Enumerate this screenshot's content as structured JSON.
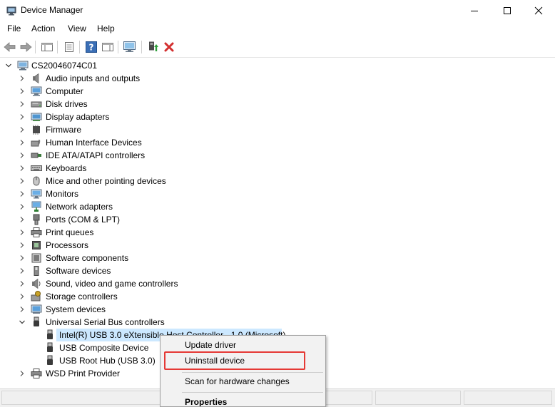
{
  "window": {
    "title": "Device Manager",
    "icon": "device-manager-icon"
  },
  "menu": {
    "items": [
      "File",
      "Action",
      "View",
      "Help"
    ]
  },
  "toolbar": {
    "buttons": [
      "back-arrow-icon",
      "forward-arrow-icon",
      "show-hide-console-tree-icon",
      "properties-icon",
      "help-icon",
      "action-pane-icon",
      "monitor-scan-icon",
      "update-driver-icon",
      "uninstall-x-icon"
    ]
  },
  "tree": {
    "root": "CS20046074C01",
    "categories": [
      {
        "label": "Audio inputs and outputs",
        "icon": "speaker-icon"
      },
      {
        "label": "Computer",
        "icon": "computer-icon"
      },
      {
        "label": "Disk drives",
        "icon": "disk-drive-icon"
      },
      {
        "label": "Display adapters",
        "icon": "display-adapter-icon"
      },
      {
        "label": "Firmware",
        "icon": "firmware-chip-icon"
      },
      {
        "label": "Human Interface Devices",
        "icon": "hid-icon"
      },
      {
        "label": "IDE ATA/ATAPI controllers",
        "icon": "ide-controller-icon"
      },
      {
        "label": "Keyboards",
        "icon": "keyboard-icon"
      },
      {
        "label": "Mice and other pointing devices",
        "icon": "mouse-icon"
      },
      {
        "label": "Monitors",
        "icon": "monitor-icon"
      },
      {
        "label": "Network adapters",
        "icon": "network-adapter-icon"
      },
      {
        "label": "Ports (COM & LPT)",
        "icon": "port-icon"
      },
      {
        "label": "Print queues",
        "icon": "printer-icon"
      },
      {
        "label": "Processors",
        "icon": "processor-icon"
      },
      {
        "label": "Software components",
        "icon": "software-component-icon"
      },
      {
        "label": "Software devices",
        "icon": "software-device-icon"
      },
      {
        "label": "Sound, video and game controllers",
        "icon": "sound-icon"
      },
      {
        "label": "Storage controllers",
        "icon": "storage-controller-icon"
      },
      {
        "label": "System devices",
        "icon": "system-device-icon"
      },
      {
        "label": "Universal Serial Bus controllers",
        "icon": "usb-icon"
      }
    ],
    "usb_children": [
      {
        "label": "Intel(R) USB 3.0 eXtensible Host Controller - 1.0 (Microsoft)",
        "selected": true
      },
      {
        "label": "USB Composite Device"
      },
      {
        "label": "USB Root Hub (USB 3.0)"
      }
    ],
    "last_category": {
      "label": "WSD Print Provider",
      "icon": "wsd-printer-icon"
    }
  },
  "context_menu": {
    "items": [
      {
        "label": "Update driver"
      },
      {
        "label": "Uninstall device",
        "highlighted": true
      },
      {
        "label": "Scan for hardware changes"
      },
      {
        "label": "Properties",
        "bold": true
      }
    ],
    "highlight_color": "#e53935"
  },
  "colors": {
    "selection": "#cce8ff",
    "accent_red": "#d32f2f"
  }
}
